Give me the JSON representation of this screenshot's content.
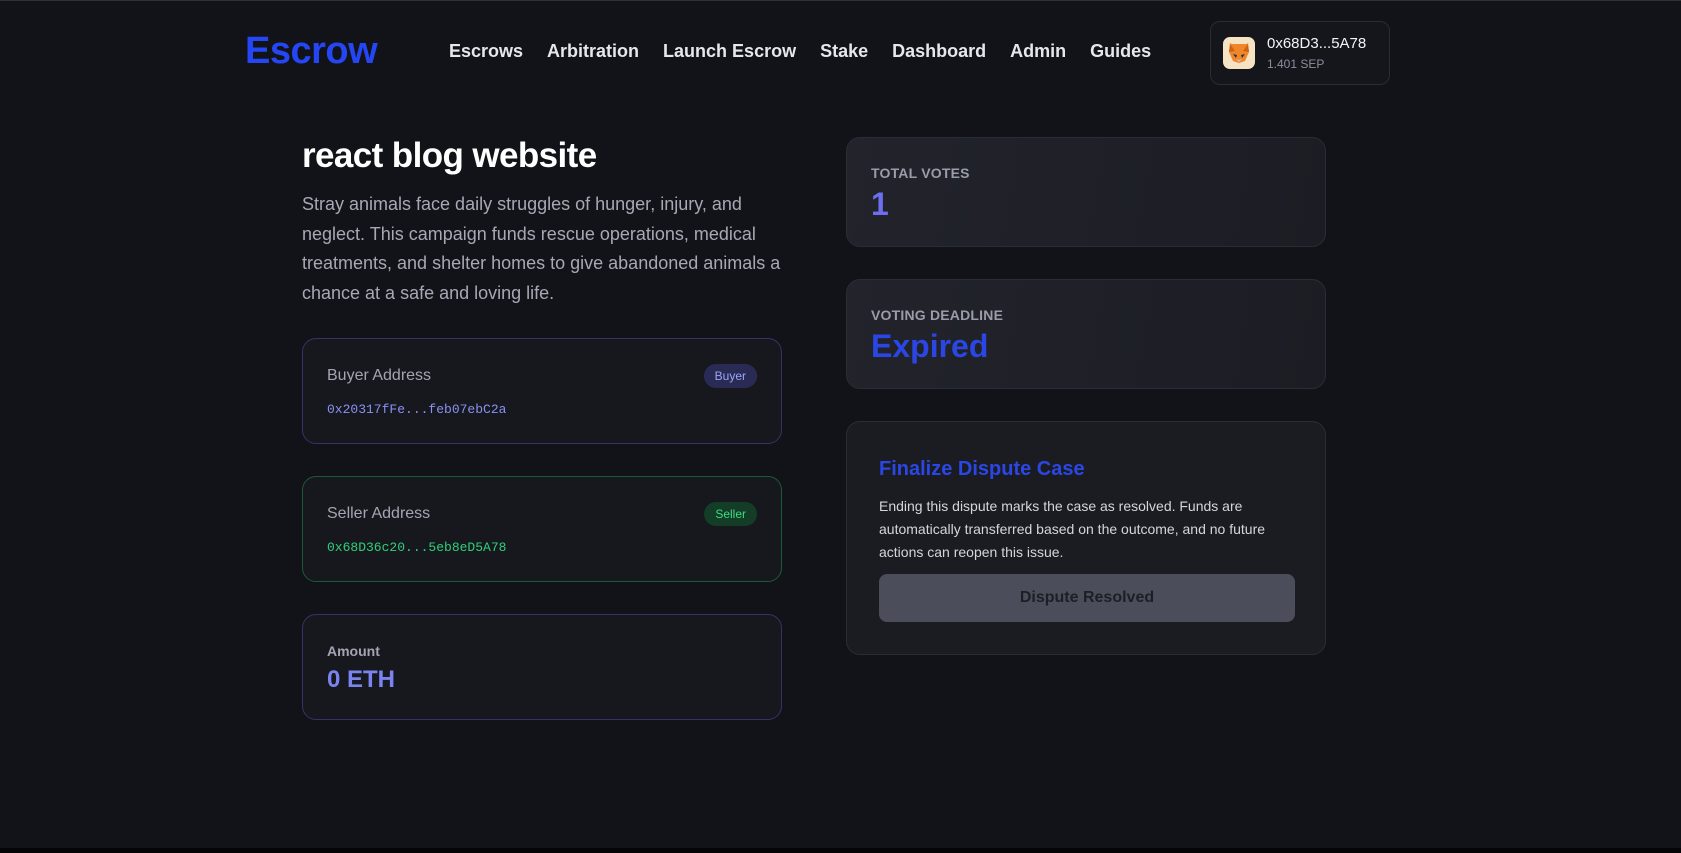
{
  "header": {
    "logo": "Escrow",
    "nav": [
      "Escrows",
      "Arbitration",
      "Launch Escrow",
      "Stake",
      "Dashboard",
      "Admin",
      "Guides"
    ],
    "wallet": {
      "icon": "metamask-fox-icon",
      "address": "0x68D3...5A78",
      "balance": "1.401 SEP"
    }
  },
  "escrow": {
    "title": "react blog website",
    "description": "Stray animals face daily struggles of hunger, injury, and neglect. This campaign funds rescue operations, medical treatments, and shelter homes to give abandoned animals a chance at a safe and loving life.",
    "buyer": {
      "label": "Buyer Address",
      "badge": "Buyer",
      "address": "0x20317fFe...feb07ebC2a"
    },
    "seller": {
      "label": "Seller Address",
      "badge": "Seller",
      "address": "0x68D36c20...5eb8eD5A78"
    },
    "amount": {
      "label": "Amount",
      "value": "0 ETH"
    }
  },
  "voting": {
    "total_votes_label": "TOTAL VOTES",
    "total_votes": "1",
    "deadline_label": "VOTING DEADLINE",
    "deadline": "Expired"
  },
  "finalize": {
    "title": "Finalize Dispute Case",
    "text": "Ending this dispute marks the case as resolved. Funds are automatically transferred based on the outcome, and no future actions can reopen this issue.",
    "button_label": "Dispute Resolved"
  },
  "colors": {
    "background": "#121318",
    "accent": "#2546f5",
    "buyer": "#8a91f2",
    "seller": "#2fd07a"
  }
}
